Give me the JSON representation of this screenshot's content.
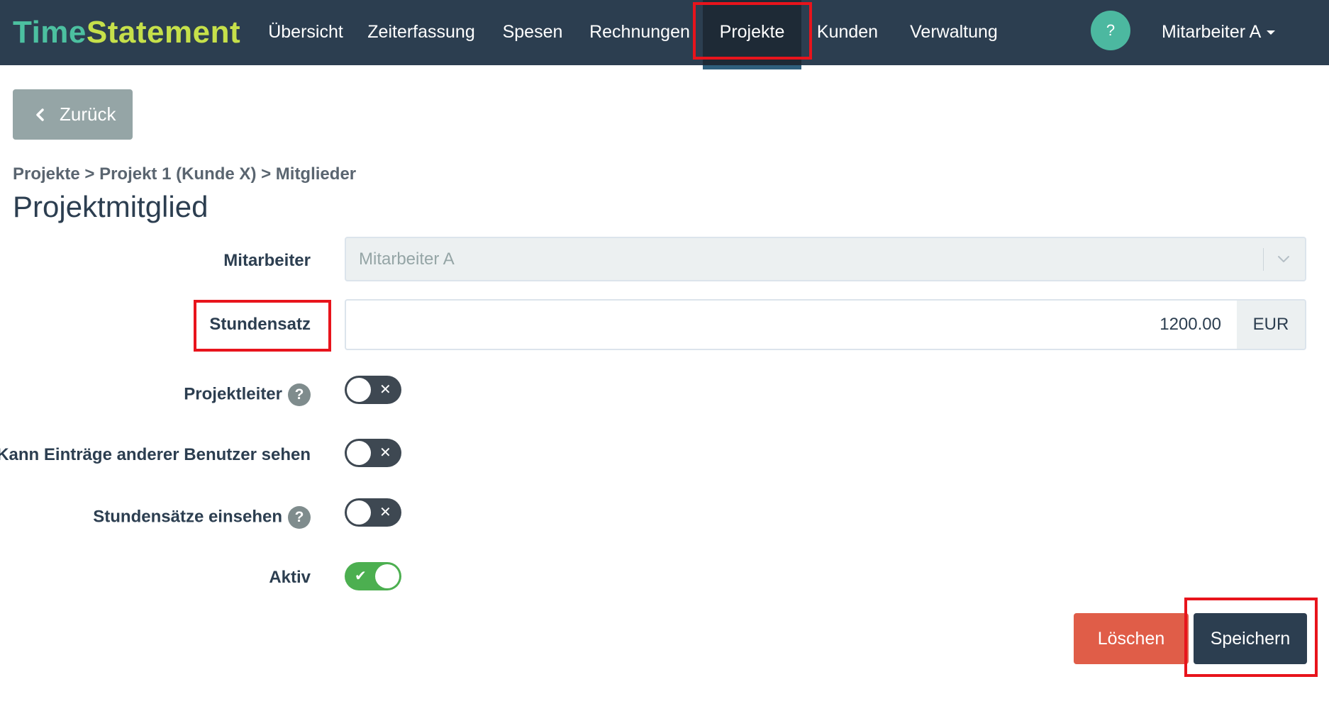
{
  "brand": {
    "part1": "Time",
    "part2": "Statement"
  },
  "nav": {
    "items": [
      {
        "label": "Übersicht"
      },
      {
        "label": "Zeiterfassung"
      },
      {
        "label": "Spesen"
      },
      {
        "label": "Rechnungen"
      },
      {
        "label": "Projekte",
        "active": true
      },
      {
        "label": "Kunden"
      },
      {
        "label": "Verwaltung"
      }
    ],
    "help": "?",
    "user": "Mitarbeiter A"
  },
  "back": {
    "label": "Zurück"
  },
  "breadcrumb": "Projekte > Projekt 1 (Kunde X) > Mitglieder",
  "title": "Projektmitglied",
  "form": {
    "employee": {
      "label": "Mitarbeiter",
      "value": "Mitarbeiter A"
    },
    "rate": {
      "label": "Stundensatz",
      "value": "1200.00",
      "currency": "EUR"
    },
    "project_lead": {
      "label": "Projektleiter",
      "help": "?",
      "on": false
    },
    "see_others": {
      "label": "Kann Einträge anderer Benutzer sehen",
      "on": false
    },
    "see_rates": {
      "label": "Stundensätze einsehen",
      "help": "?",
      "on": false
    },
    "active": {
      "label": "Aktiv",
      "on": true
    }
  },
  "actions": {
    "delete": "Löschen",
    "save": "Speichern"
  },
  "colors": {
    "navbar": "#2c3e50",
    "accent": "#4cc0a0",
    "brand_secondary": "#c6e04a",
    "danger": "#e05d48",
    "success": "#4caf50",
    "highlight": "#e8141c"
  }
}
